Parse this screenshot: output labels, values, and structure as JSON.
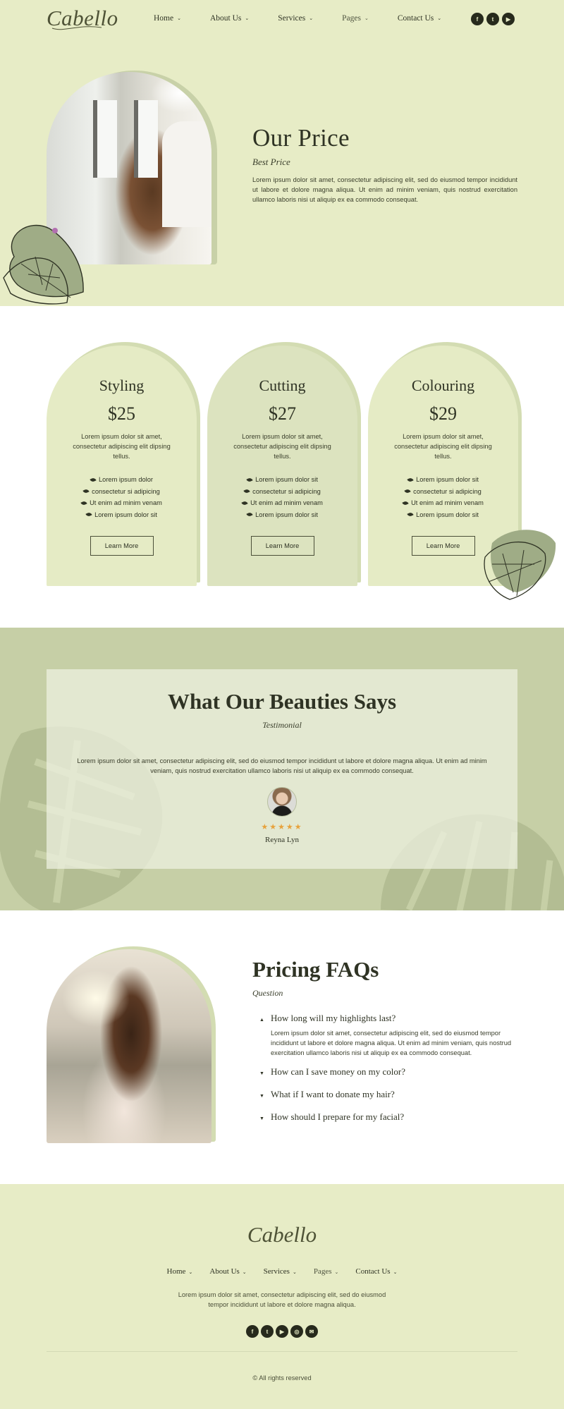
{
  "brand": {
    "logo": "Cabello"
  },
  "nav": {
    "items": [
      {
        "label": "Home"
      },
      {
        "label": "About Us"
      },
      {
        "label": "Services"
      },
      {
        "label": "Pages"
      },
      {
        "label": "Contact Us"
      }
    ],
    "chevron": "⌄",
    "socials": [
      "facebook-icon",
      "twitter-icon",
      "youtube-icon"
    ]
  },
  "hero": {
    "title": "Our Price",
    "subtitle": "Best Price",
    "body": "Lorem ipsum dolor sit amet, consectetur adipiscing elit, sed do eiusmod tempor incididunt ut labore et dolore magna aliqua. Ut enim ad minim veniam, quis nostrud exercitation ullamco laboris nisi ut aliquip ex ea commodo consequat."
  },
  "pricing": {
    "cards": [
      {
        "title": "Styling",
        "price": "$25",
        "desc": "Lorem ipsum dolor sit amet, consectetur adipiscing elit dipsing tellus.",
        "features": [
          "Lorem ipsum dolor",
          "consectetur si adipicing",
          "Ut enim ad minim venam",
          "Lorem ipsum dolor sit"
        ],
        "button": "Learn More"
      },
      {
        "title": "Cutting",
        "price": "$27",
        "desc": "Lorem ipsum dolor sit amet, consectetur adipiscing elit dipsing tellus.",
        "features": [
          "Lorem ipsum dolor sit",
          "consectetur si adipicing",
          "Ut enim ad minim venam",
          "Lorem ipsum dolor sit"
        ],
        "button": "Learn More"
      },
      {
        "title": "Colouring",
        "price": "$29",
        "desc": "Lorem ipsum dolor sit amet, consectetur adipiscing elit dipsing tellus.",
        "features": [
          "Lorem ipsum dolor sit",
          "consectetur si adipicing",
          "Ut enim ad minim venam",
          "Lorem ipsum dolor sit"
        ],
        "button": "Learn More"
      }
    ]
  },
  "testimonial": {
    "title": "What Our Beauties Says",
    "subtitle": "Testimonial",
    "body": "Lorem ipsum dolor sit amet, consectetur adipiscing elit, sed do eiusmod tempor incididunt ut labore et dolore magna aliqua. Ut enim ad minim veniam, quis nostrud exercitation ullamco laboris nisi ut aliquip ex ea commodo consequat.",
    "stars": "★★★★★",
    "rating": 5,
    "name": "Reyna Lyn"
  },
  "faq": {
    "title": "Pricing FAQs",
    "subtitle": "Question",
    "open_caret": "▲",
    "closed_caret": "▼",
    "items": [
      {
        "q": "How long will my highlights last?",
        "a": "Lorem ipsum dolor sit amet, consectetur adipiscing elit, sed do eiusmod tempor incididunt ut labore et dolore magna aliqua. Ut enim ad minim veniam, quis nostrud exercitation ullamco laboris nisi ut aliquip ex ea commodo consequat."
      },
      {
        "q": "How can I save money on my color?"
      },
      {
        "q": "What if I want to donate my hair?"
      },
      {
        "q": "How should I prepare for my facial?"
      }
    ]
  },
  "footer": {
    "logo": "Cabello",
    "desc": "Lorem ipsum dolor sit amet, consectetur adipiscing elit, sed do eiusmod tempor incididunt ut labore et dolore magna aliqua.",
    "socials": [
      "facebook-icon",
      "twitter-icon",
      "youtube-icon",
      "dribbble-icon",
      "email-icon"
    ],
    "copyright": "© All rights reserved"
  },
  "colors": {
    "cream_green": "#e7ecc6",
    "sage": "#c6cfa6",
    "dark": "#2f3324",
    "star": "#e7a23c"
  }
}
